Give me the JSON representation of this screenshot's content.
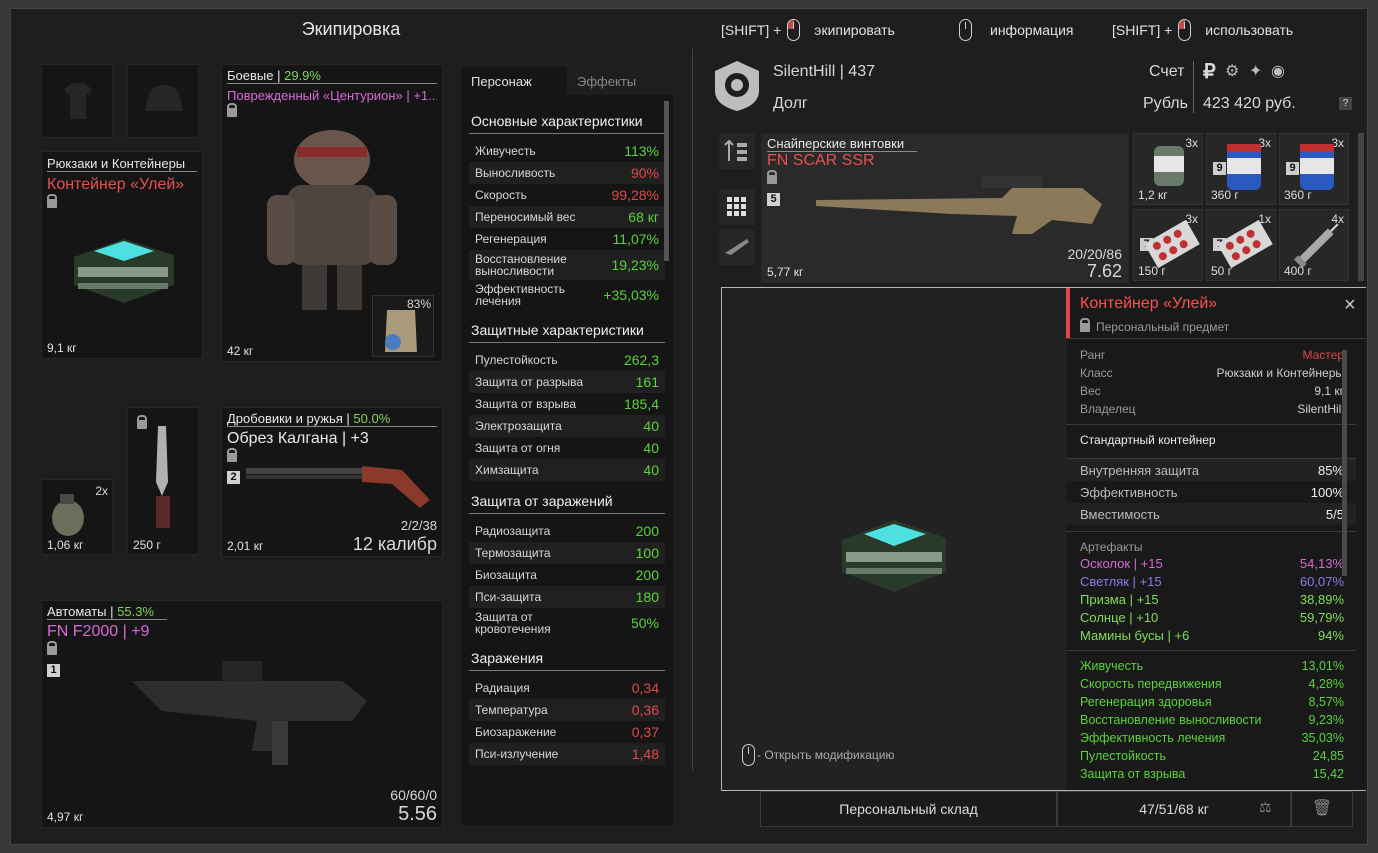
{
  "header": {
    "title": "Экипировка"
  },
  "hints": [
    {
      "prefix": "[SHIFT] +",
      "label": "экипировать"
    },
    {
      "prefix": "",
      "label": "информация"
    },
    {
      "prefix": "[SHIFT] +",
      "label": "использовать"
    }
  ],
  "equip": {
    "backpack": {
      "category": "Рюкзаки и Контейнеры",
      "name": "Контейнер «Улей»",
      "weight": "9,1 кг"
    },
    "armor": {
      "category": "Боевые",
      "pct": "29.9%",
      "name": "Поврежденный «Центурион» | +1...",
      "weight": "42 кг",
      "plate_pct": "83%"
    },
    "grenade": {
      "count": "2x",
      "weight": "1,06 кг"
    },
    "knife": {
      "weight": "250 г"
    },
    "shotgun": {
      "category": "Дробовики и ружья",
      "pct": "50.0%",
      "name": "Обрез Калгана | +3",
      "slot": "2",
      "ammo": "2/2/38",
      "caliber": "12 калибр",
      "weight": "2,01 кг"
    },
    "rifle": {
      "category": "Автоматы",
      "pct": "55.3%",
      "name": "FN F2000 | +9",
      "slot": "1",
      "ammo": "60/60/0",
      "caliber": "5.56",
      "weight": "4,97 кг"
    }
  },
  "stats": {
    "tabs": [
      "Персонаж",
      "Эффекты"
    ],
    "sections": [
      {
        "title": "Основные характеристики",
        "rows": [
          {
            "k": "Живучесть",
            "v": "113%",
            "c": "g"
          },
          {
            "k": "Выносливость",
            "v": "90%",
            "c": "r"
          },
          {
            "k": "Скорость",
            "v": "99,28%",
            "c": "r"
          },
          {
            "k": "Переносимый вес",
            "v": "68 кг",
            "c": "g"
          },
          {
            "k": "Регенерация",
            "v": "11,07%",
            "c": "g"
          },
          {
            "k": "Восстановление выносливости",
            "v": "19,23%",
            "c": "g"
          },
          {
            "k": "Эффективность лечения",
            "v": "+35,03%",
            "c": "g"
          }
        ]
      },
      {
        "title": "Защитные характеристики",
        "rows": [
          {
            "k": "Пулестойкость",
            "v": "262,3",
            "c": "g"
          },
          {
            "k": "Защита от разрыва",
            "v": "161",
            "c": "g"
          },
          {
            "k": "Защита от взрыва",
            "v": "185,4",
            "c": "g"
          },
          {
            "k": "Электрозащита",
            "v": "40",
            "c": "g"
          },
          {
            "k": "Защита от огня",
            "v": "40",
            "c": "g"
          },
          {
            "k": "Химзащита",
            "v": "40",
            "c": "g"
          }
        ]
      },
      {
        "title": "Защита от заражений",
        "rows": [
          {
            "k": "Радиозащита",
            "v": "200",
            "c": "g"
          },
          {
            "k": "Термозащита",
            "v": "100",
            "c": "g"
          },
          {
            "k": "Биозащита",
            "v": "200",
            "c": "g"
          },
          {
            "k": "Пси-защита",
            "v": "180",
            "c": "g"
          },
          {
            "k": "Защита от кровотечения",
            "v": "50%",
            "c": "g"
          }
        ]
      },
      {
        "title": "Заражения",
        "rows": [
          {
            "k": "Радиация",
            "v": "0,34",
            "c": "r"
          },
          {
            "k": "Температура",
            "v": "0,36",
            "c": "r"
          },
          {
            "k": "Биозаражение",
            "v": "0,37",
            "c": "r"
          },
          {
            "k": "Пси-излучение",
            "v": "1,48",
            "c": "r"
          }
        ]
      }
    ]
  },
  "player": {
    "name": "SilentHill",
    "level": "437",
    "faction": "Долг",
    "account_label": "Счет",
    "currency_label": "Рубль",
    "balance": "423 420 руб.",
    "help": "?"
  },
  "stash": {
    "weapon": {
      "category": "Снайперские винтовки",
      "name": "FN SCAR SSR",
      "slot": "5",
      "ammo": "20/20/86",
      "caliber": "7.62",
      "weight": "5,77 кг"
    },
    "items": [
      {
        "count": "3x",
        "weight": "1,2 кг",
        "lvl": ""
      },
      {
        "count": "3x",
        "weight": "360 г",
        "lvl": "9"
      },
      {
        "count": "3x",
        "weight": "360 г",
        "lvl": "9"
      },
      {
        "count": "3x",
        "weight": "150 г",
        "lvl": "7"
      },
      {
        "count": "1x",
        "weight": "50 г",
        "lvl": "7"
      },
      {
        "count": "4x",
        "weight": "400 г",
        "lvl": ""
      }
    ],
    "footer": {
      "label": "Персональный склад",
      "weight": "47/51/68 кг"
    }
  },
  "info": {
    "title": "Контейнер «Улей»",
    "subtitle": "Персональный предмет",
    "open_mods": "- Открыть модификацию",
    "props": [
      {
        "k": "Ранг",
        "v": "Мастер"
      },
      {
        "k": "Класс",
        "v": "Рюкзаки и Контейнеры"
      },
      {
        "k": "Вес",
        "v": "9,1 кг"
      },
      {
        "k": "Владелец",
        "v": "SilentHill"
      }
    ],
    "desc": "Стандартный контейнер",
    "params": [
      {
        "k": "Внутренняя защита",
        "v": "85%"
      },
      {
        "k": "Эффективность",
        "v": "100%"
      },
      {
        "k": "Вместимость",
        "v": "5/5"
      }
    ],
    "artifacts_title": "Артефакты",
    "artifacts": [
      {
        "k": "Осколок | +15",
        "v": "54,13%",
        "color": "#d86ad8"
      },
      {
        "k": "Светляк | +15",
        "v": "60,07%",
        "color": "#8a7ae8"
      },
      {
        "k": "Призма | +15",
        "v": "38,89%",
        "color": "#7fdc5a"
      },
      {
        "k": "Солнце | +10",
        "v": "59,79%",
        "color": "#7fdc5a"
      },
      {
        "k": "Мамины бусы | +6",
        "v": "94%",
        "color": "#7fdc5a"
      }
    ],
    "bonuses": [
      {
        "k": "Живучесть",
        "v": "13,01%"
      },
      {
        "k": "Скорость передвижения",
        "v": "4,28%"
      },
      {
        "k": "Регенерация здоровья",
        "v": "8,57%"
      },
      {
        "k": "Восстановление выносливости",
        "v": "9,23%"
      },
      {
        "k": "Эффективность лечения",
        "v": "35,03%"
      },
      {
        "k": "Пулестойкость",
        "v": "24,85"
      },
      {
        "k": "Защита от взрыва",
        "v": "15,42"
      }
    ]
  }
}
